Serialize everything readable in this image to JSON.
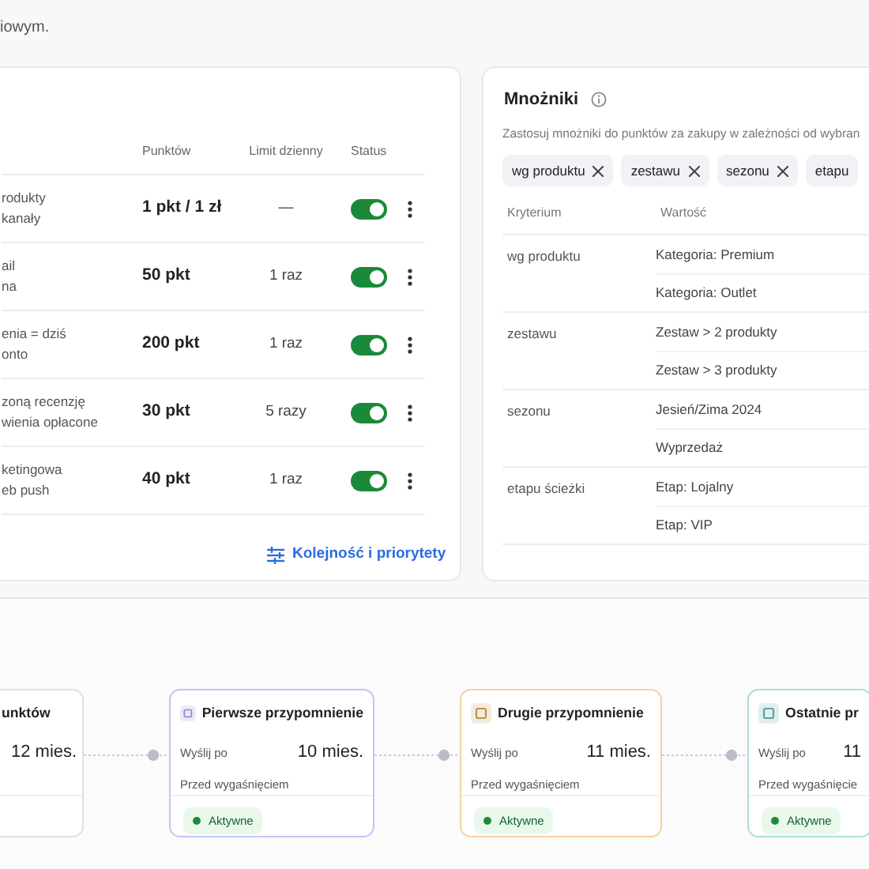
{
  "intro": {
    "text": "iowym."
  },
  "rules": {
    "columns": [
      "Punktów",
      "Limit dzienny",
      "Status"
    ],
    "rows": [
      {
        "lines": [
          "rodukty",
          "kanały"
        ],
        "points": "1 pkt / 1 zł",
        "limit": "—",
        "on": true
      },
      {
        "lines": [
          "ail",
          "na"
        ],
        "points": "50 pkt",
        "limit": "1 raz",
        "on": true
      },
      {
        "lines": [
          "enia = dziś",
          "onto"
        ],
        "points": "200 pkt",
        "limit": "1 raz",
        "on": true
      },
      {
        "lines": [
          "zoną recenzję",
          "wienia opłacone"
        ],
        "points": "30 pkt",
        "limit": "5 razy",
        "on": true
      },
      {
        "lines": [
          "ketingowa",
          "eb push"
        ],
        "points": "40 pkt",
        "limit": "1 raz",
        "on": true
      }
    ],
    "link": "Kolejność i priorytety"
  },
  "multipliers": {
    "title": "Mnożniki",
    "subtitle": "Zastosuj mnożniki do punktów za zakupy w zależności od wybran",
    "chips": [
      {
        "label": "wg produktu",
        "closable": true
      },
      {
        "label": "zestawu",
        "closable": true
      },
      {
        "label": "sezonu",
        "closable": true
      },
      {
        "label": "etapu",
        "closable": false
      }
    ],
    "columns": [
      "Kryterium",
      "Wartość"
    ],
    "groups": [
      {
        "criterion": "wg produktu",
        "values": [
          "Kategoria: Premium",
          "Kategoria: Outlet"
        ]
      },
      {
        "criterion": "zestawu",
        "values": [
          "Zestaw > 2 produkty",
          "Zestaw > 3 produkty"
        ]
      },
      {
        "criterion": "sezonu",
        "values": [
          "Jesień/Zima 2024",
          "Wyprzedaż"
        ]
      },
      {
        "criterion": "etapu ścieżki",
        "values": [
          "Etap: Lojalny",
          "Etap: VIP"
        ]
      }
    ]
  },
  "timeline": {
    "steps": [
      {
        "kind": "start",
        "title": "unktów",
        "value": "12 mies."
      },
      {
        "kind": "reminder",
        "title": "Pierwsze przypomnienie",
        "color": "#c9c1f6",
        "label": "Wyślij po",
        "value": "10 mies.",
        "note": "Przed wygaśnięciem",
        "status": "Aktywne"
      },
      {
        "kind": "reminder",
        "title": "Drugie przypomnienie",
        "color": "#f6d2a2",
        "label": "Wyślij po",
        "value": "11 mies.",
        "note": "Przed wygaśnięciem",
        "status": "Aktywne"
      },
      {
        "kind": "reminder",
        "title": "Ostatnie pr",
        "color": "#a9dedc",
        "label": "Wyślij po",
        "value": "11",
        "note": "Przed wygaśnięcie",
        "status": "Aktywne"
      }
    ]
  }
}
